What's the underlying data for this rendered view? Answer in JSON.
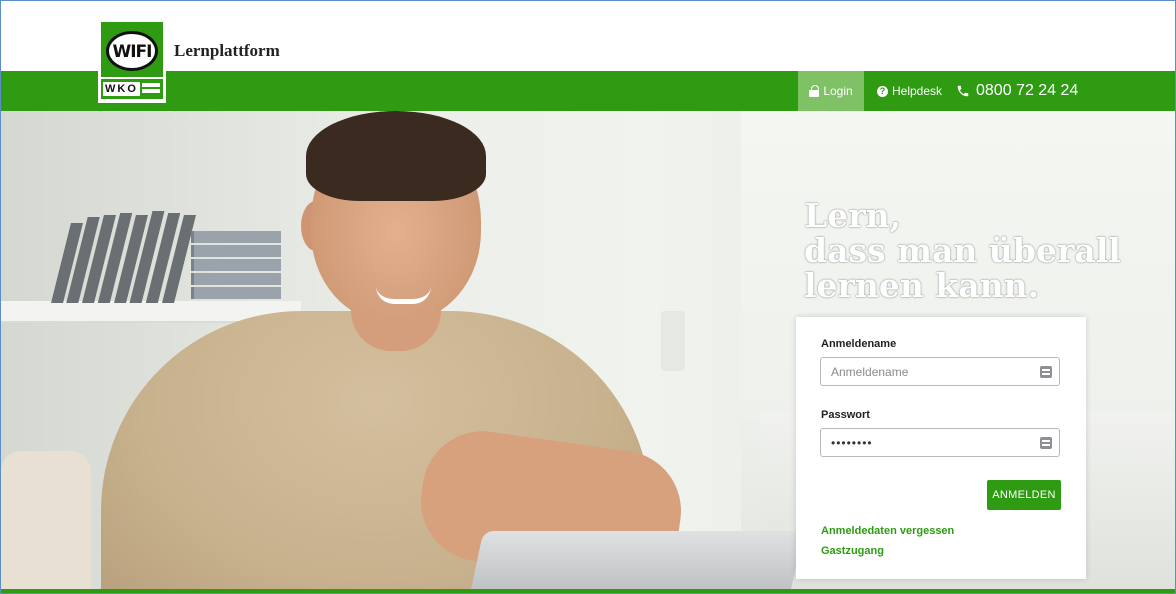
{
  "header": {
    "app_title": "Lernplattform",
    "logo": {
      "top_text": "WIFI",
      "bottom_text": "WKO"
    }
  },
  "nav": {
    "login_label": "Login",
    "helpdesk_label": "Helpdesk",
    "phone": "0800 72 24 24"
  },
  "hero": {
    "slogan_line1": "Lern,",
    "slogan_line2": "dass man überall",
    "slogan_line3": "lernen kann."
  },
  "login_form": {
    "username_label": "Anmeldename",
    "username_placeholder": "Anmeldename",
    "password_label": "Passwort",
    "password_value": "••••••••",
    "submit_label": "ANMELDEN",
    "forgot_link": "Anmeldedaten vergessen",
    "guest_link": "Gastzugang"
  },
  "colors": {
    "brand_green": "#2e9b13",
    "active_nav": "#7fc266"
  }
}
